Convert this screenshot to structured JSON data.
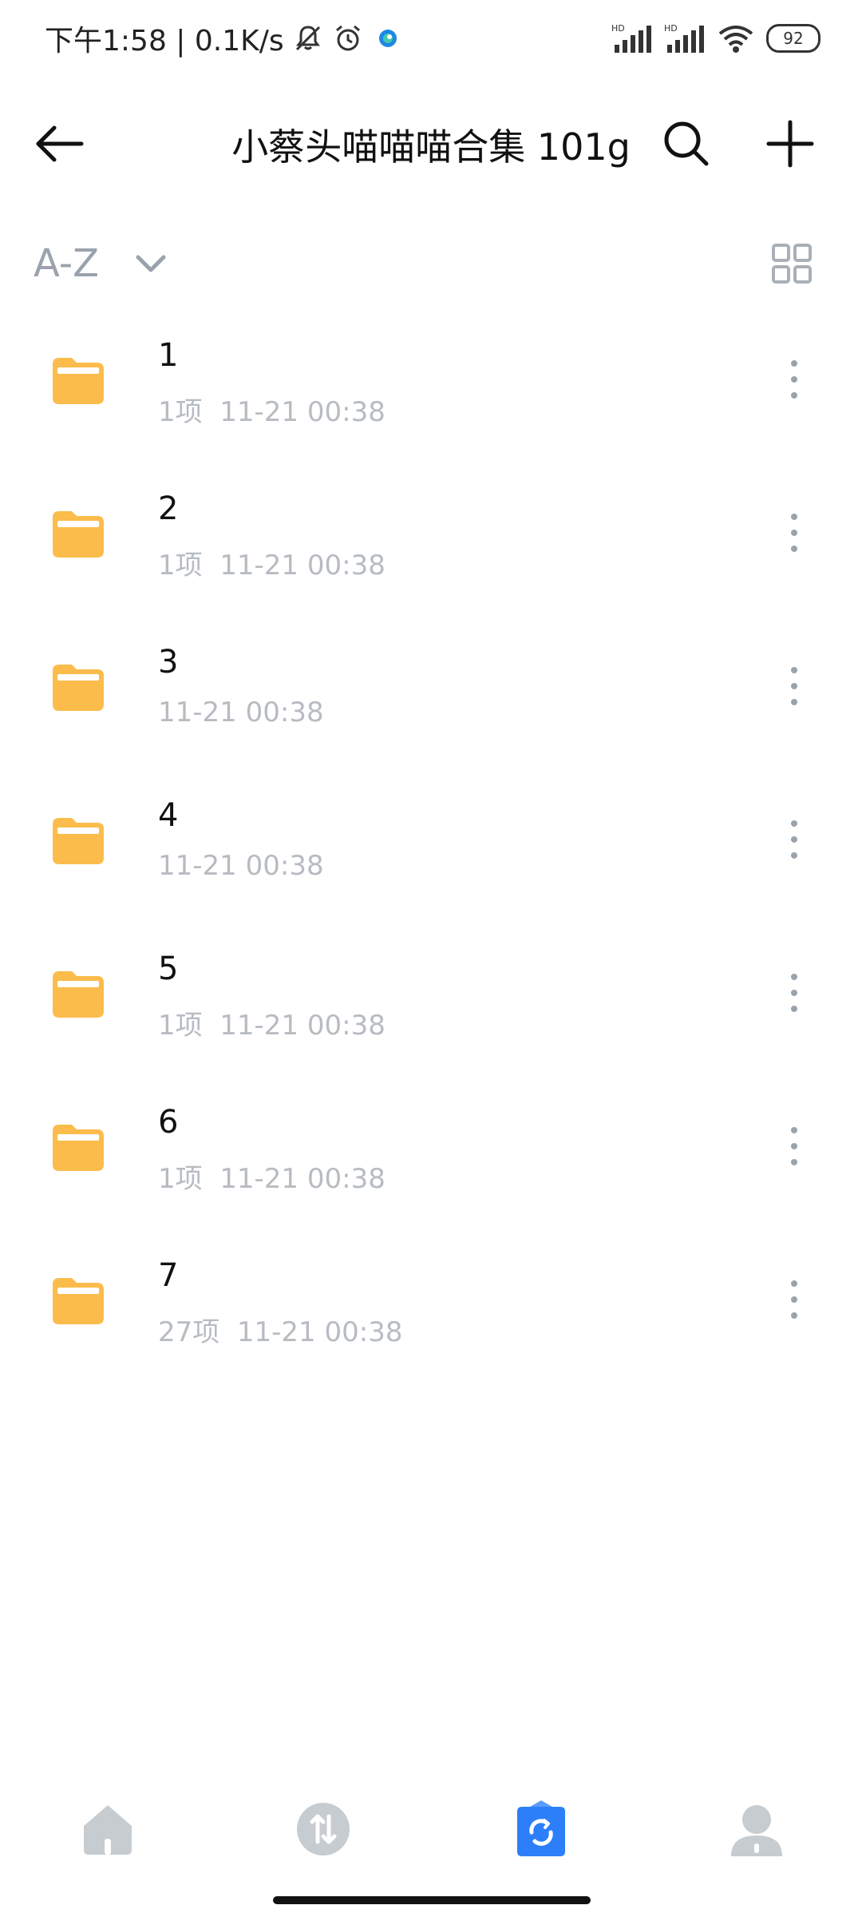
{
  "status_bar": {
    "time_speed": "下午1:58 | 0.1K/s",
    "battery": "92",
    "signal1_label": "HD",
    "signal2_label": "HD"
  },
  "header": {
    "title": "小蔡头喵喵喵合集 101g"
  },
  "sort": {
    "label": "A-Z"
  },
  "files": [
    {
      "name": "1",
      "meta": "1项  11-21 00:38"
    },
    {
      "name": "2",
      "meta": "1项  11-21 00:38"
    },
    {
      "name": "3",
      "meta": "11-21 00:38"
    },
    {
      "name": "4",
      "meta": "11-21 00:38"
    },
    {
      "name": "5",
      "meta": "1项  11-21 00:38"
    },
    {
      "name": "6",
      "meta": "1项  11-21 00:38"
    },
    {
      "name": "7",
      "meta": "27项  11-21 00:38"
    }
  ],
  "bottom_nav": [
    {
      "icon": "home-icon",
      "active": false
    },
    {
      "icon": "transfer-icon",
      "active": false
    },
    {
      "icon": "files-sync-icon",
      "active": true
    },
    {
      "icon": "profile-icon",
      "active": false
    }
  ],
  "colors": {
    "folder": "#fbbc4b",
    "folder_tab": "#f5a623",
    "nav_inactive": "#c7ccd1",
    "nav_active": "#2d7ff9"
  }
}
